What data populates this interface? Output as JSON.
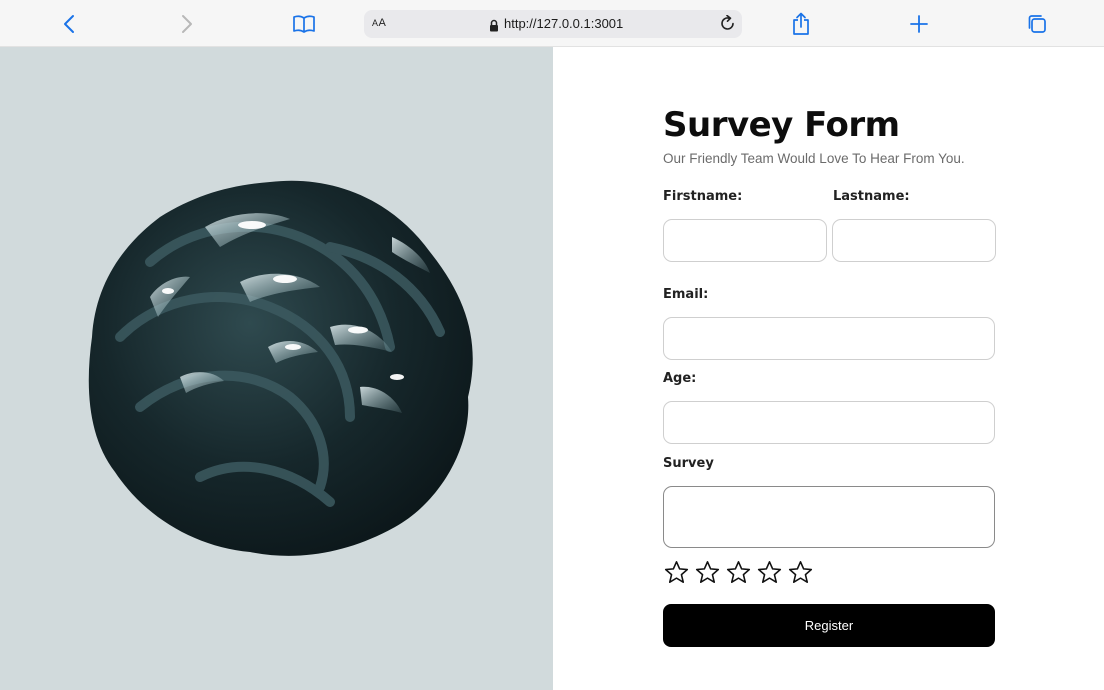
{
  "browser": {
    "text_size_label_small": "A",
    "text_size_label_large": "A",
    "url": "http://127.0.0.1:3001",
    "accent_color": "#1a73e8"
  },
  "hero": {
    "background_color": "#d1dadc"
  },
  "form": {
    "title": "Survey Form",
    "subtitle": "Our Friendly Team Would Love To Hear From You.",
    "firstname_label": "Firstname:",
    "lastname_label": "Lastname:",
    "email_label": "Email:",
    "age_label": "Age:",
    "survey_label": "Survey",
    "rating": {
      "max": 5,
      "value": 0
    },
    "register_label": "Register"
  }
}
